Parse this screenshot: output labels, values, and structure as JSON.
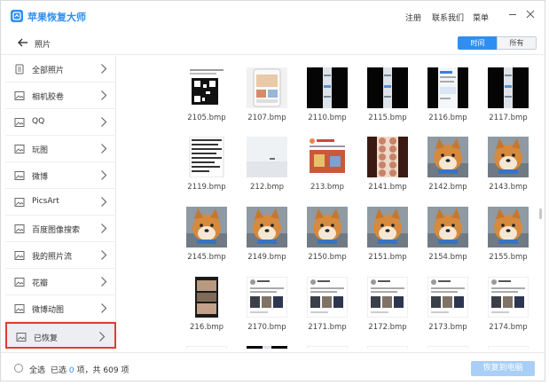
{
  "app": {
    "title": "苹果恢复大师"
  },
  "titlebar": {
    "register": "注册",
    "contact": "联系我们",
    "menu": "菜单"
  },
  "nav": {
    "title": "照片",
    "seg_time": "时间",
    "seg_all": "所有"
  },
  "sidebar": {
    "items": [
      {
        "label": "全部照片",
        "icon": "document-icon"
      },
      {
        "label": "相机胶卷",
        "icon": "image-icon"
      },
      {
        "label": "QQ",
        "icon": "image-icon"
      },
      {
        "label": "玩图",
        "icon": "image-icon"
      },
      {
        "label": "微博",
        "icon": "image-icon"
      },
      {
        "label": "PicsArt",
        "icon": "image-icon"
      },
      {
        "label": "百度图像搜索",
        "icon": "image-icon"
      },
      {
        "label": "我的照片流",
        "icon": "image-icon"
      },
      {
        "label": "花瓣",
        "icon": "image-icon"
      },
      {
        "label": "微博动图",
        "icon": "image-icon"
      },
      {
        "label": "已恢复",
        "icon": "image-icon",
        "selected": true
      }
    ]
  },
  "gallery": {
    "rows": [
      [
        {
          "name": "2105.bmp",
          "kind": "qr"
        },
        {
          "name": "2107.bmp",
          "kind": "phone"
        },
        {
          "name": "2110.bmp",
          "kind": "black"
        },
        {
          "name": "2115.bmp",
          "kind": "black"
        },
        {
          "name": "2116.bmp",
          "kind": "chat"
        },
        {
          "name": "2117.bmp",
          "kind": "black"
        }
      ],
      [
        {
          "name": "2119.bmp",
          "kind": "textdark"
        },
        {
          "name": "212.bmp",
          "kind": "sky"
        },
        {
          "name": "213.bmp",
          "kind": "social"
        },
        {
          "name": "2141.bmp",
          "kind": "faces"
        },
        {
          "name": "2142.bmp",
          "kind": "dog"
        },
        {
          "name": "2143.bmp",
          "kind": "dog"
        }
      ],
      [
        {
          "name": "2145.bmp",
          "kind": "dog"
        },
        {
          "name": "2149.bmp",
          "kind": "dog"
        },
        {
          "name": "2150.bmp",
          "kind": "dog"
        },
        {
          "name": "2151.bmp",
          "kind": "dog"
        },
        {
          "name": "2154.bmp",
          "kind": "dog"
        },
        {
          "name": "2155.bmp",
          "kind": "dog"
        }
      ],
      [
        {
          "name": "216.bmp",
          "kind": "phone2"
        },
        {
          "name": "2170.bmp",
          "kind": "post"
        },
        {
          "name": "2171.bmp",
          "kind": "post"
        },
        {
          "name": "2172.bmp",
          "kind": "post"
        },
        {
          "name": "2173.bmp",
          "kind": "post"
        },
        {
          "name": "2174.bmp",
          "kind": "post"
        }
      ],
      [
        {
          "name": "",
          "kind": "post"
        },
        {
          "name": "",
          "kind": "black"
        },
        {
          "name": "",
          "kind": "post"
        },
        {
          "name": "",
          "kind": "post"
        },
        {
          "name": "",
          "kind": "post"
        },
        {
          "name": "",
          "kind": "post"
        }
      ]
    ]
  },
  "footer": {
    "select_all": "全选",
    "selected_prefix": "已选",
    "selected_count": "0",
    "selected_suffix": "项，共 609 项",
    "recover_button": "恢复到电脑"
  },
  "colors": {
    "accent": "#2f8ff0",
    "highlight_border": "#e53935"
  }
}
